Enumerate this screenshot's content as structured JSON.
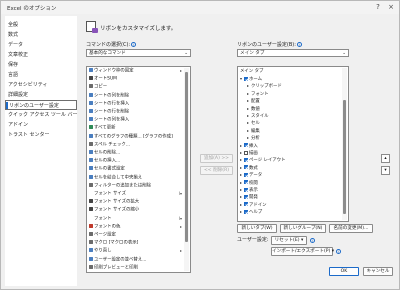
{
  "window": {
    "title": "Excel のオプション"
  },
  "sidebar": {
    "items": [
      {
        "label": "全般"
      },
      {
        "label": "数式"
      },
      {
        "label": "データ"
      },
      {
        "label": "文章校正"
      },
      {
        "label": "保存"
      },
      {
        "label": "言語"
      },
      {
        "label": "アクセシビリティ"
      },
      {
        "label": "詳細設定"
      },
      {
        "label": "リボンのユーザー設定",
        "selected": true
      },
      {
        "label": "クイック アクセス ツール バー"
      },
      {
        "label": "アドイン"
      },
      {
        "label": "トラスト センター"
      }
    ]
  },
  "header": {
    "text": "リボンをカスタマイズします。"
  },
  "left": {
    "label": "コマンドの選択(C):",
    "combo_value": "基本的なコマンド",
    "commands": [
      {
        "label": "ウィンドウ枠の固定",
        "icon": "#4a7ebf",
        "sub": "▸"
      },
      {
        "label": "オートSUM",
        "icon": "#444444",
        "sub": ""
      },
      {
        "label": "コピー",
        "icon": "#6b6b6b",
        "sub": ""
      },
      {
        "label": "シートの列を削除",
        "icon": "#4a7ebf",
        "sub": ""
      },
      {
        "label": "シートの行を挿入",
        "icon": "#4a7ebf",
        "sub": ""
      },
      {
        "label": "シートの行を削除",
        "icon": "#4a7ebf",
        "sub": ""
      },
      {
        "label": "シートの列を挿入",
        "icon": "#4a7ebf",
        "sub": ""
      },
      {
        "label": "すべて更新",
        "icon": "#2e8b57",
        "sub": ""
      },
      {
        "label": "すべてのグラフの種類... [グラフの作成]",
        "icon": "#4a7ebf",
        "sub": ""
      },
      {
        "label": "スペル チェック...",
        "icon": "#6b6b6b",
        "sub": ""
      },
      {
        "label": "セルの削除...",
        "icon": "#4a7ebf",
        "sub": ""
      },
      {
        "label": "セルの挿入...",
        "icon": "#4a7ebf",
        "sub": ""
      },
      {
        "label": "セルの書式設定",
        "icon": "#4a7ebf",
        "sub": ""
      },
      {
        "label": "セルを結合して中央揃え",
        "icon": "#4a7ebf",
        "sub": ""
      },
      {
        "label": "フィルターの追加または削除",
        "icon": "#6b6b6b",
        "sub": ""
      },
      {
        "label": "フォント サイズ",
        "icon": "",
        "sub": "I▾"
      },
      {
        "label": "フォント サイズの拡大",
        "icon": "#444444",
        "sub": ""
      },
      {
        "label": "フォント サイズの縮小",
        "icon": "#444444",
        "sub": ""
      },
      {
        "label": "フォント",
        "icon": "",
        "sub": "I▾"
      },
      {
        "label": "フォントの色",
        "icon": "#c0392b",
        "sub": "▸"
      },
      {
        "label": "ページ設定",
        "icon": "#6b6b6b",
        "sub": ""
      },
      {
        "label": "マクロ [マクロの表示]",
        "icon": "#6b6b6b",
        "sub": ""
      },
      {
        "label": "やり直し",
        "icon": "#4a7ebf",
        "sub": "▸"
      },
      {
        "label": "ユーザー設定の並べ替え...",
        "icon": "#4a7ebf",
        "sub": ""
      },
      {
        "label": "印刷プレビューと印刷",
        "icon": "#6b6b6b",
        "sub": ""
      }
    ]
  },
  "center": {
    "add_label": "追加(A) >>",
    "remove_label": "<< 削除(R)"
  },
  "right": {
    "label": "リボンのユーザー設定(B):",
    "combo_value": "メイン タブ",
    "tree_title": "メイン タブ",
    "tree": [
      {
        "label": "ホーム",
        "level": 1,
        "checkbox": true,
        "checked": true,
        "expander": "▾"
      },
      {
        "label": "クリップボード",
        "level": 2,
        "checkbox": false,
        "checked": false,
        "expander": "▸"
      },
      {
        "label": "フォント",
        "level": 2,
        "checkbox": false,
        "checked": false,
        "expander": "▸"
      },
      {
        "label": "配置",
        "level": 2,
        "checkbox": false,
        "checked": false,
        "expander": "▸"
      },
      {
        "label": "数値",
        "level": 2,
        "checkbox": false,
        "checked": false,
        "expander": "▸"
      },
      {
        "label": "スタイル",
        "level": 2,
        "checkbox": false,
        "checked": false,
        "expander": "▸"
      },
      {
        "label": "セル",
        "level": 2,
        "checkbox": false,
        "checked": false,
        "expander": "▸"
      },
      {
        "label": "編集",
        "level": 2,
        "checkbox": false,
        "checked": false,
        "expander": "▸"
      },
      {
        "label": "分析",
        "level": 2,
        "checkbox": false,
        "checked": false,
        "expander": "▸"
      },
      {
        "label": "挿入",
        "level": 1,
        "checkbox": true,
        "checked": true,
        "expander": "▸"
      },
      {
        "label": "描画",
        "level": 1,
        "checkbox": true,
        "checked": false,
        "expander": "▸"
      },
      {
        "label": "ページ レイアウト",
        "level": 1,
        "checkbox": true,
        "checked": true,
        "expander": "▸"
      },
      {
        "label": "数式",
        "level": 1,
        "checkbox": true,
        "checked": true,
        "expander": "▸"
      },
      {
        "label": "データ",
        "level": 1,
        "checkbox": true,
        "checked": true,
        "expander": "▸"
      },
      {
        "label": "校閲",
        "level": 1,
        "checkbox": true,
        "checked": true,
        "expander": "▸"
      },
      {
        "label": "表示",
        "level": 1,
        "checkbox": true,
        "checked": true,
        "expander": "▸"
      },
      {
        "label": "開発",
        "level": 1,
        "checkbox": true,
        "checked": true,
        "expander": "▸"
      },
      {
        "label": "アドイン",
        "level": 1,
        "checkbox": true,
        "checked": true,
        "expander": "▸"
      },
      {
        "label": "ヘルプ",
        "level": 1,
        "checkbox": true,
        "checked": true,
        "expander": "▸"
      }
    ],
    "new_tab": "新しいタブ(W)",
    "new_group": "新しいグループ(N)",
    "rename": "名前の変更(M)...",
    "user_settings_label": "ユーザー設定:",
    "reset": "リセット(E) ▾",
    "import_export": "インポート/エクスポート(P) ▾"
  },
  "footer": {
    "ok": "OK",
    "cancel": "キャンセル"
  },
  "colors": {
    "accent": "#1b6ac9"
  }
}
